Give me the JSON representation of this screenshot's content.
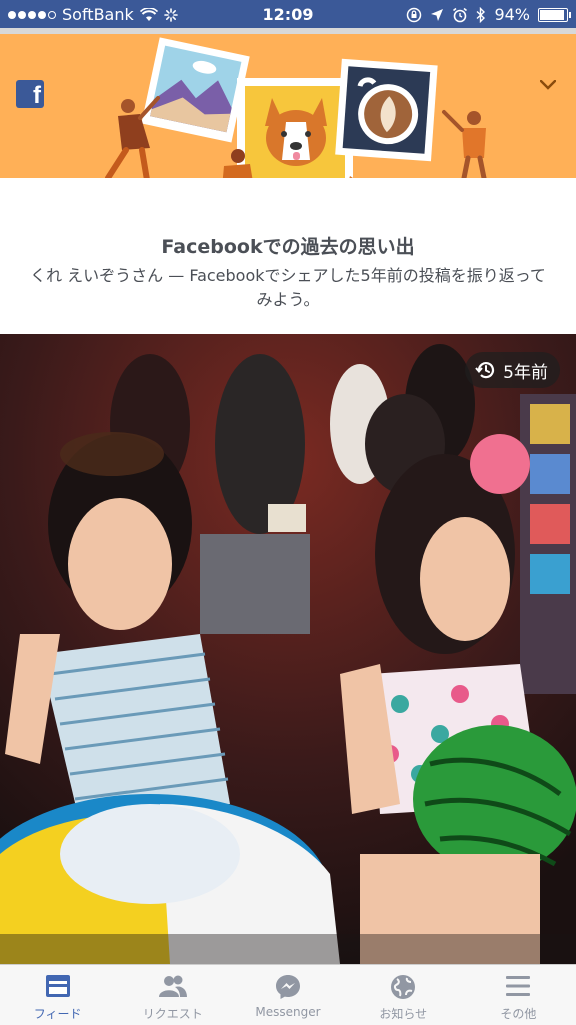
{
  "status_bar": {
    "carrier": "SoftBank",
    "time": "12:09",
    "battery": "94%",
    "battery_level": 0.94
  },
  "header": {
    "logo_icon": "facebook-logo-icon",
    "menu_icon": "chevron-down-icon",
    "accent": "#ffb057"
  },
  "memory": {
    "title": "Facebookでの過去の思い出",
    "subtitle": "くれ えいぞうさん — Facebookでシェアした5年前の投稿を振り返ってみよう。"
  },
  "post": {
    "years_ago": "5年前",
    "badge_icon": "history-clock-icon"
  },
  "tabs": [
    {
      "label": "フィード",
      "icon": "news-feed-icon",
      "active": true
    },
    {
      "label": "リクエスト",
      "icon": "friend-requests-icon",
      "active": false
    },
    {
      "label": "Messenger",
      "icon": "messenger-icon",
      "active": false
    },
    {
      "label": "お知らせ",
      "icon": "globe-notifications-icon",
      "active": false
    },
    {
      "label": "その他",
      "icon": "hamburger-menu-icon",
      "active": false
    }
  ],
  "colors": {
    "brand": "#3b5998",
    "active_tab": "#4267b2",
    "inactive_tab": "#9197a3"
  }
}
